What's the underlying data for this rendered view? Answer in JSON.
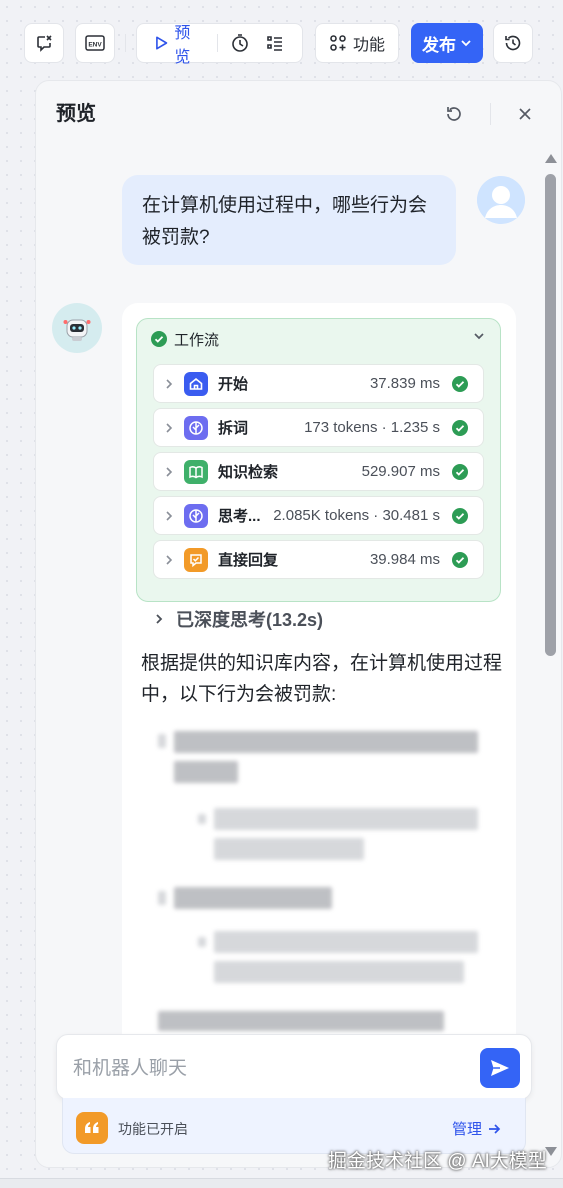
{
  "toolbar": {
    "icons": [
      "clear-context-icon",
      "env-icon",
      "play-icon",
      "timer-icon",
      "checklist-icon",
      "grid-icon",
      "chevron-down-icon",
      "history-icon"
    ],
    "env_label": "ENV",
    "preview_label": "预览",
    "feature_label": "功能",
    "publish_label": "发布"
  },
  "panel": {
    "title": "预览"
  },
  "chat": {
    "user_message": "在计算机使用过程中，哪些行为会被罚款?",
    "workflow": {
      "title": "工作流",
      "steps": [
        {
          "name": "开始",
          "meta": "37.839 ms",
          "icon": "home-icon",
          "color": "#3a5cf0"
        },
        {
          "name": "拆词",
          "meta": "173 tokens · 1.235 s",
          "icon": "split-icon",
          "color": "#6d6df0"
        },
        {
          "name": "知识检索",
          "meta": "529.907 ms",
          "icon": "book-icon",
          "color": "#3fb06a"
        },
        {
          "name": "思考...",
          "meta": "2.085K tokens · 30.481 s",
          "icon": "think-icon",
          "color": "#6d6df0"
        },
        {
          "name": "直接回复",
          "meta": "39.984 ms",
          "icon": "reply-icon",
          "color": "#f29a28"
        }
      ]
    },
    "deep_think_label": "已深度思考(13.2s)",
    "answer_intro": "根据提供的知识库内容，在计算机使用过程中，以下行为会被罚款:"
  },
  "input": {
    "placeholder": "和机器人聊天"
  },
  "feature_bar": {
    "label": "功能已开启",
    "manage_label": "管理"
  },
  "watermark": "掘金技术社区 @ AI大模型"
}
